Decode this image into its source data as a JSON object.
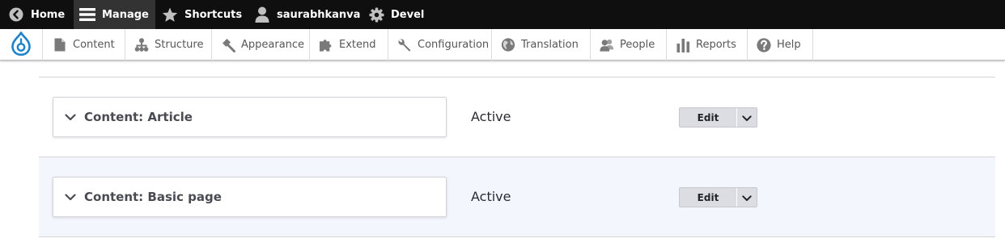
{
  "toolbar": {
    "items": [
      {
        "label": "Home",
        "icon": "back-arrow-circle-icon"
      },
      {
        "label": "Manage",
        "icon": "hamburger-menu-icon"
      },
      {
        "label": "Shortcuts",
        "icon": "star-icon"
      },
      {
        "label": "saurabhkanva",
        "icon": "user-icon"
      },
      {
        "label": "Devel",
        "icon": "gear-icon"
      }
    ]
  },
  "tray": {
    "logo_icon": "drupal-drop-icon",
    "items": [
      {
        "label": "Content",
        "icon": "document-icon"
      },
      {
        "label": "Structure",
        "icon": "sitemap-icon"
      },
      {
        "label": "Appearance",
        "icon": "paint-roller-icon"
      },
      {
        "label": "Extend",
        "icon": "puzzle-icon"
      },
      {
        "label": "Configuration",
        "icon": "wrench-icon"
      },
      {
        "label": "Translation",
        "icon": "globe-icon"
      },
      {
        "label": "People",
        "icon": "people-icon"
      },
      {
        "label": "Reports",
        "icon": "bar-chart-icon"
      },
      {
        "label": "Help",
        "icon": "help-circle-icon"
      }
    ]
  },
  "rows": [
    {
      "summary": "Content: Article",
      "status": "Active",
      "edit_label": "Edit"
    },
    {
      "summary": "Content: Basic page",
      "status": "Active",
      "edit_label": "Edit"
    }
  ],
  "colors": {
    "toolbar_bg": "#0f0f0f",
    "toolbar_active": "#333333",
    "drupal_blue": "#1e83c9",
    "row_alt_bg": "#f3f6fd",
    "button_bg": "#dcdde3"
  }
}
